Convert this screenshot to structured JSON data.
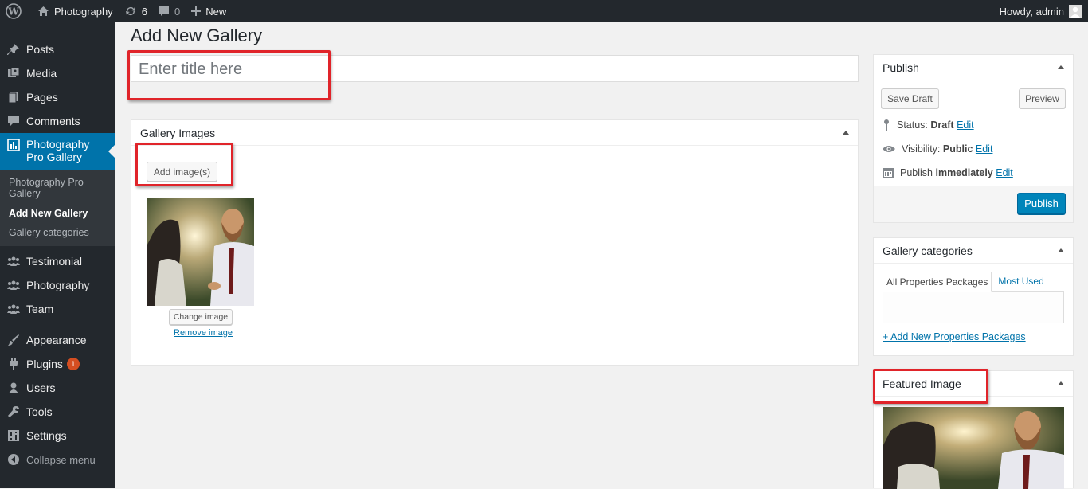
{
  "adminbar": {
    "site_name": "Photography",
    "updates_count": "6",
    "comments_count": "0",
    "new_label": "New",
    "greeting": "Howdy, admin"
  },
  "sidebar": {
    "items": [
      {
        "label": "Posts",
        "icon": "pin-icon"
      },
      {
        "label": "Media",
        "icon": "media-icon"
      },
      {
        "label": "Pages",
        "icon": "pages-icon"
      },
      {
        "label": "Comments",
        "icon": "comments-icon"
      },
      {
        "label": "Photography Pro Gallery",
        "icon": "gallery-icon"
      },
      {
        "label": "Testimonial",
        "icon": "groups-icon"
      },
      {
        "label": "Photography",
        "icon": "groups-icon"
      },
      {
        "label": "Team",
        "icon": "groups-icon"
      },
      {
        "label": "Appearance",
        "icon": "brush-icon"
      },
      {
        "label": "Plugins",
        "icon": "plug-icon"
      },
      {
        "label": "Users",
        "icon": "user-icon"
      },
      {
        "label": "Tools",
        "icon": "wrench-icon"
      },
      {
        "label": "Settings",
        "icon": "settings-icon"
      }
    ],
    "submenu": [
      "Photography Pro Gallery",
      "Add New Gallery",
      "Gallery categories"
    ],
    "plugins_badge": "1",
    "collapse_label": "Collapse menu"
  },
  "page": {
    "title": "Add New Gallery",
    "title_placeholder": "Enter title here"
  },
  "gallery_images": {
    "heading": "Gallery Images",
    "add_button": "Add image(s)",
    "change_button": "Change image",
    "remove_link": "Remove image"
  },
  "publish": {
    "heading": "Publish",
    "save_draft": "Save Draft",
    "preview": "Preview",
    "status_label": "Status:",
    "status_value": "Draft",
    "visibility_label": "Visibility:",
    "visibility_value": "Public",
    "publish_label": "Publish",
    "publish_value": "immediately",
    "edit": "Edit",
    "publish_button": "Publish"
  },
  "categories": {
    "heading": "Gallery categories",
    "tab_all": "All Properties Packages",
    "tab_used": "Most Used",
    "add_link": "+ Add New Properties Packages"
  },
  "featured": {
    "heading": "Featured Image"
  },
  "colors": {
    "admin_dark": "#23282d",
    "accent_blue": "#0073aa",
    "highlight_red": "#e0242a"
  }
}
